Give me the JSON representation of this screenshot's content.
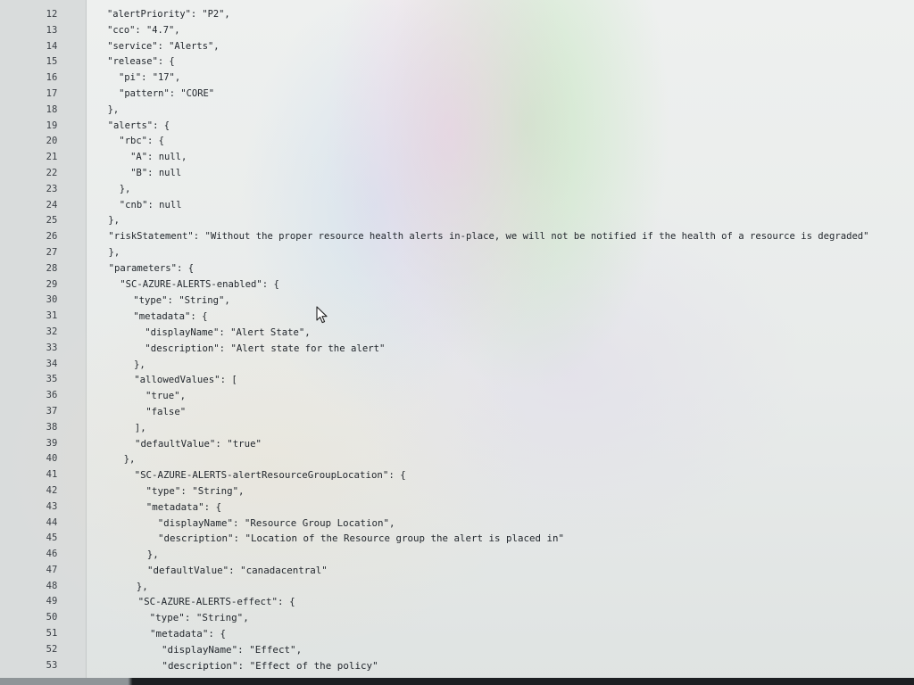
{
  "editor": {
    "lines": [
      {
        "number": "12",
        "text": "\"alertPriority\": \"P2\","
      },
      {
        "number": "13",
        "text": "\"cco\": \"4.7\","
      },
      {
        "number": "14",
        "text": "\"service\": \"Alerts\","
      },
      {
        "number": "15",
        "text": "\"release\": {"
      },
      {
        "number": "16",
        "text": "  \"pi\": \"17\","
      },
      {
        "number": "17",
        "text": "  \"pattern\": \"CORE\""
      },
      {
        "number": "18",
        "text": "},"
      },
      {
        "number": "19",
        "text": "\"alerts\": {"
      },
      {
        "number": "20",
        "text": "  \"rbc\": {"
      },
      {
        "number": "21",
        "text": "    \"A\": null,"
      },
      {
        "number": "22",
        "text": "    \"B\": null"
      },
      {
        "number": "23",
        "text": "  },"
      },
      {
        "number": "24",
        "text": "  \"cnb\": null"
      },
      {
        "number": "25",
        "text": "},"
      },
      {
        "number": "26",
        "text": "\"riskStatement\": \"Without the proper resource health alerts in-place, we will not be notified if the health of a resource is degraded\""
      },
      {
        "number": "27",
        "text": "},"
      },
      {
        "number": "28",
        "text": "\"parameters\": {"
      },
      {
        "number": "29",
        "text": "  \"SC-AZURE-ALERTS-enabled\": {"
      },
      {
        "number": "30",
        "text": "    \"type\": \"String\","
      },
      {
        "number": "31",
        "text": "    \"metadata\": {"
      },
      {
        "number": "32",
        "text": "      \"displayName\": \"Alert State\","
      },
      {
        "number": "33",
        "text": "      \"description\": \"Alert state for the alert\""
      },
      {
        "number": "34",
        "text": "    },"
      },
      {
        "number": "35",
        "text": "    \"allowedValues\": ["
      },
      {
        "number": "36",
        "text": "      \"true\","
      },
      {
        "number": "37",
        "text": "      \"false\""
      },
      {
        "number": "38",
        "text": "    ],"
      },
      {
        "number": "39",
        "text": "    \"defaultValue\": \"true\""
      },
      {
        "number": "40",
        "text": "  },"
      },
      {
        "number": "41",
        "text": "  \"SC-AZURE-ALERTS-alertResourceGroupLocation\": {"
      },
      {
        "number": "42",
        "text": "    \"type\": \"String\","
      },
      {
        "number": "43",
        "text": "    \"metadata\": {"
      },
      {
        "number": "44",
        "text": "      \"displayName\": \"Resource Group Location\","
      },
      {
        "number": "45",
        "text": "      \"description\": \"Location of the Resource group the alert is placed in\""
      },
      {
        "number": "46",
        "text": "    },"
      },
      {
        "number": "47",
        "text": "    \"defaultValue\": \"canadacentral\""
      },
      {
        "number": "48",
        "text": "  },"
      },
      {
        "number": "49",
        "text": "  \"SC-AZURE-ALERTS-effect\": {"
      },
      {
        "number": "50",
        "text": "    \"type\": \"String\","
      },
      {
        "number": "51",
        "text": "    \"metadata\": {"
      },
      {
        "number": "52",
        "text": "      \"displayName\": \"Effect\","
      },
      {
        "number": "53",
        "text": "      \"description\": \"Effect of the policy\""
      }
    ]
  },
  "cursor": {
    "icon": "mouse-pointer-icon"
  },
  "colors": {
    "text": "#23282e",
    "line_number": "#3a3f45",
    "background": "#e8ebea"
  }
}
